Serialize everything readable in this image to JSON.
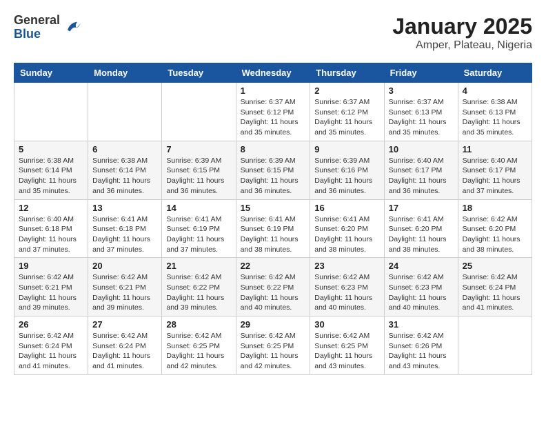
{
  "header": {
    "logo": {
      "general": "General",
      "blue": "Blue"
    },
    "title": "January 2025",
    "subtitle": "Amper, Plateau, Nigeria"
  },
  "weekdays": [
    "Sunday",
    "Monday",
    "Tuesday",
    "Wednesday",
    "Thursday",
    "Friday",
    "Saturday"
  ],
  "weeks": [
    [
      {
        "day": "",
        "sunrise": "",
        "sunset": "",
        "daylight": ""
      },
      {
        "day": "",
        "sunrise": "",
        "sunset": "",
        "daylight": ""
      },
      {
        "day": "",
        "sunrise": "",
        "sunset": "",
        "daylight": ""
      },
      {
        "day": "1",
        "sunrise": "Sunrise: 6:37 AM",
        "sunset": "Sunset: 6:12 PM",
        "daylight": "Daylight: 11 hours and 35 minutes."
      },
      {
        "day": "2",
        "sunrise": "Sunrise: 6:37 AM",
        "sunset": "Sunset: 6:12 PM",
        "daylight": "Daylight: 11 hours and 35 minutes."
      },
      {
        "day": "3",
        "sunrise": "Sunrise: 6:37 AM",
        "sunset": "Sunset: 6:13 PM",
        "daylight": "Daylight: 11 hours and 35 minutes."
      },
      {
        "day": "4",
        "sunrise": "Sunrise: 6:38 AM",
        "sunset": "Sunset: 6:13 PM",
        "daylight": "Daylight: 11 hours and 35 minutes."
      }
    ],
    [
      {
        "day": "5",
        "sunrise": "Sunrise: 6:38 AM",
        "sunset": "Sunset: 6:14 PM",
        "daylight": "Daylight: 11 hours and 35 minutes."
      },
      {
        "day": "6",
        "sunrise": "Sunrise: 6:38 AM",
        "sunset": "Sunset: 6:14 PM",
        "daylight": "Daylight: 11 hours and 36 minutes."
      },
      {
        "day": "7",
        "sunrise": "Sunrise: 6:39 AM",
        "sunset": "Sunset: 6:15 PM",
        "daylight": "Daylight: 11 hours and 36 minutes."
      },
      {
        "day": "8",
        "sunrise": "Sunrise: 6:39 AM",
        "sunset": "Sunset: 6:15 PM",
        "daylight": "Daylight: 11 hours and 36 minutes."
      },
      {
        "day": "9",
        "sunrise": "Sunrise: 6:39 AM",
        "sunset": "Sunset: 6:16 PM",
        "daylight": "Daylight: 11 hours and 36 minutes."
      },
      {
        "day": "10",
        "sunrise": "Sunrise: 6:40 AM",
        "sunset": "Sunset: 6:17 PM",
        "daylight": "Daylight: 11 hours and 36 minutes."
      },
      {
        "day": "11",
        "sunrise": "Sunrise: 6:40 AM",
        "sunset": "Sunset: 6:17 PM",
        "daylight": "Daylight: 11 hours and 37 minutes."
      }
    ],
    [
      {
        "day": "12",
        "sunrise": "Sunrise: 6:40 AM",
        "sunset": "Sunset: 6:18 PM",
        "daylight": "Daylight: 11 hours and 37 minutes."
      },
      {
        "day": "13",
        "sunrise": "Sunrise: 6:41 AM",
        "sunset": "Sunset: 6:18 PM",
        "daylight": "Daylight: 11 hours and 37 minutes."
      },
      {
        "day": "14",
        "sunrise": "Sunrise: 6:41 AM",
        "sunset": "Sunset: 6:19 PM",
        "daylight": "Daylight: 11 hours and 37 minutes."
      },
      {
        "day": "15",
        "sunrise": "Sunrise: 6:41 AM",
        "sunset": "Sunset: 6:19 PM",
        "daylight": "Daylight: 11 hours and 38 minutes."
      },
      {
        "day": "16",
        "sunrise": "Sunrise: 6:41 AM",
        "sunset": "Sunset: 6:20 PM",
        "daylight": "Daylight: 11 hours and 38 minutes."
      },
      {
        "day": "17",
        "sunrise": "Sunrise: 6:41 AM",
        "sunset": "Sunset: 6:20 PM",
        "daylight": "Daylight: 11 hours and 38 minutes."
      },
      {
        "day": "18",
        "sunrise": "Sunrise: 6:42 AM",
        "sunset": "Sunset: 6:20 PM",
        "daylight": "Daylight: 11 hours and 38 minutes."
      }
    ],
    [
      {
        "day": "19",
        "sunrise": "Sunrise: 6:42 AM",
        "sunset": "Sunset: 6:21 PM",
        "daylight": "Daylight: 11 hours and 39 minutes."
      },
      {
        "day": "20",
        "sunrise": "Sunrise: 6:42 AM",
        "sunset": "Sunset: 6:21 PM",
        "daylight": "Daylight: 11 hours and 39 minutes."
      },
      {
        "day": "21",
        "sunrise": "Sunrise: 6:42 AM",
        "sunset": "Sunset: 6:22 PM",
        "daylight": "Daylight: 11 hours and 39 minutes."
      },
      {
        "day": "22",
        "sunrise": "Sunrise: 6:42 AM",
        "sunset": "Sunset: 6:22 PM",
        "daylight": "Daylight: 11 hours and 40 minutes."
      },
      {
        "day": "23",
        "sunrise": "Sunrise: 6:42 AM",
        "sunset": "Sunset: 6:23 PM",
        "daylight": "Daylight: 11 hours and 40 minutes."
      },
      {
        "day": "24",
        "sunrise": "Sunrise: 6:42 AM",
        "sunset": "Sunset: 6:23 PM",
        "daylight": "Daylight: 11 hours and 40 minutes."
      },
      {
        "day": "25",
        "sunrise": "Sunrise: 6:42 AM",
        "sunset": "Sunset: 6:24 PM",
        "daylight": "Daylight: 11 hours and 41 minutes."
      }
    ],
    [
      {
        "day": "26",
        "sunrise": "Sunrise: 6:42 AM",
        "sunset": "Sunset: 6:24 PM",
        "daylight": "Daylight: 11 hours and 41 minutes."
      },
      {
        "day": "27",
        "sunrise": "Sunrise: 6:42 AM",
        "sunset": "Sunset: 6:24 PM",
        "daylight": "Daylight: 11 hours and 41 minutes."
      },
      {
        "day": "28",
        "sunrise": "Sunrise: 6:42 AM",
        "sunset": "Sunset: 6:25 PM",
        "daylight": "Daylight: 11 hours and 42 minutes."
      },
      {
        "day": "29",
        "sunrise": "Sunrise: 6:42 AM",
        "sunset": "Sunset: 6:25 PM",
        "daylight": "Daylight: 11 hours and 42 minutes."
      },
      {
        "day": "30",
        "sunrise": "Sunrise: 6:42 AM",
        "sunset": "Sunset: 6:25 PM",
        "daylight": "Daylight: 11 hours and 43 minutes."
      },
      {
        "day": "31",
        "sunrise": "Sunrise: 6:42 AM",
        "sunset": "Sunset: 6:26 PM",
        "daylight": "Daylight: 11 hours and 43 minutes."
      },
      {
        "day": "",
        "sunrise": "",
        "sunset": "",
        "daylight": ""
      }
    ]
  ]
}
